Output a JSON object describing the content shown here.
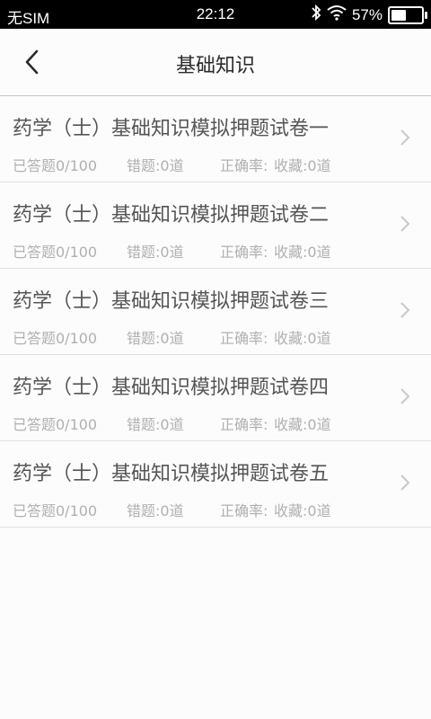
{
  "status_bar": {
    "carrier": "无SIM",
    "time": "22:12",
    "battery_percent": "57%",
    "battery_level": 0.57,
    "icons": [
      "bluetooth-icon",
      "wifi-icon",
      "battery-icon"
    ]
  },
  "nav": {
    "title": "基础知识",
    "back_icon": "chevron-left-icon"
  },
  "items": [
    {
      "title": "药学（士）基础知识模拟押题试卷一",
      "answered": "已答题0/100",
      "wrong": "错题:0道",
      "accuracy": "正确率:",
      "favorites": "收藏:0道"
    },
    {
      "title": "药学（士）基础知识模拟押题试卷二",
      "answered": "已答题0/100",
      "wrong": "错题:0道",
      "accuracy": "正确率:",
      "favorites": "收藏:0道"
    },
    {
      "title": "药学（士）基础知识模拟押题试卷三",
      "answered": "已答题0/100",
      "wrong": "错题:0道",
      "accuracy": "正确率:",
      "favorites": "收藏:0道"
    },
    {
      "title": "药学（士）基础知识模拟押题试卷四",
      "answered": "已答题0/100",
      "wrong": "错题:0道",
      "accuracy": "正确率:",
      "favorites": "收藏:0道"
    },
    {
      "title": "药学（士）基础知识模拟押题试卷五",
      "answered": "已答题0/100",
      "wrong": "错题:0道",
      "accuracy": "正确率:",
      "favorites": "收藏:0道"
    }
  ],
  "colors": {
    "title_text": "#555555",
    "meta_text": "#b0b0b0",
    "divider": "#dedede",
    "background": "#fdfcfd"
  }
}
